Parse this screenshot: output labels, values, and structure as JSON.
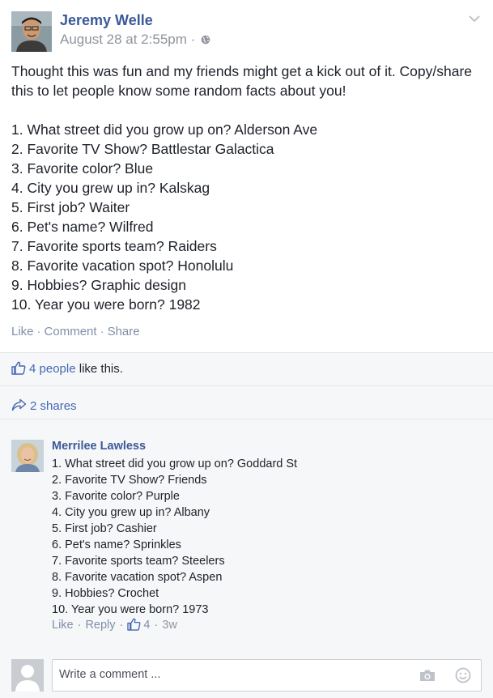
{
  "post": {
    "author": "Jeremy Welle",
    "timestamp": "August 28 at 2:55pm",
    "meta_separator": "·",
    "privacy_icon": "globe-icon",
    "intro": "Thought this was fun and my friends might get a kick out of it. Copy/share this to let people know some random facts about you!",
    "items": [
      "1. What street did you grow up on? Alderson Ave",
      "2. Favorite TV Show? Battlestar Galactica",
      "3. Favorite color? Blue",
      "4. City you grew up in? Kalskag",
      "5. First job? Waiter",
      "6. Pet's name? Wilfred",
      "7. Favorite sports team? Raiders",
      "8. Favorite vacation spot? Honolulu",
      "9. Hobbies? Graphic design",
      "10. Year you were born? 1982"
    ],
    "actions": {
      "like": "Like",
      "comment": "Comment",
      "share": "Share",
      "separator": "·"
    }
  },
  "reactions": {
    "likes_people": "4 people",
    "likes_suffix": "like this.",
    "shares": "2 shares"
  },
  "comment": {
    "author": "Merrilee Lawless",
    "lines": [
      "1. What street did you grow up on? Goddard St",
      "2. Favorite TV Show? Friends",
      "3. Favorite color? Purple",
      "4. City you grew up in? Albany",
      "5. First job? Cashier",
      "6. Pet's name? Sprinkles",
      "7. Favorite sports team? Steelers",
      "8. Favorite vacation spot? Aspen",
      "9. Hobbies? Crochet",
      "10. Year you were born? 1973"
    ],
    "actions": {
      "like": "Like",
      "reply": "Reply",
      "like_count": "4",
      "time": "3w",
      "separator": "·"
    }
  },
  "composer": {
    "placeholder": "Write a comment ..."
  },
  "colors": {
    "link": "#3b5998",
    "meta": "#90949c",
    "band": "#f6f7f9",
    "border": "#e5e6e9"
  }
}
